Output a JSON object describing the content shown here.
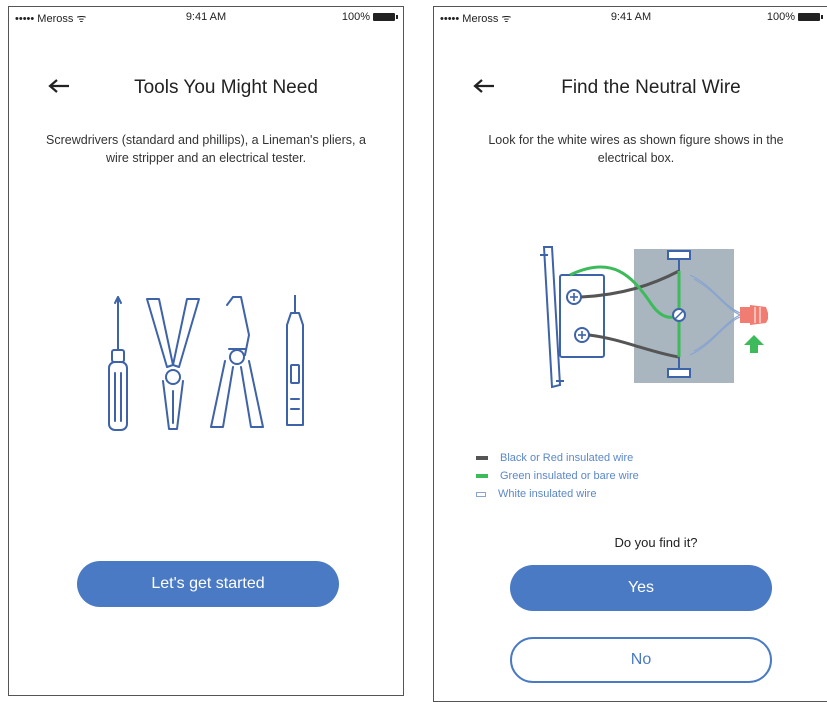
{
  "screens": [
    {
      "status": {
        "carrier": "••••• Meross ᯤ",
        "time": "9:41 AM",
        "battery": "100%"
      },
      "title": "Tools You Might Need",
      "description": "Screwdrivers (standard and phillips), a Lineman's pliers, a wire stripper and an electrical tester.",
      "button": "Let's get started",
      "icons": [
        "back-arrow-icon",
        "screwdriver-icon",
        "lineman-pliers-icon",
        "wire-stripper-icon",
        "electrical-tester-icon"
      ]
    },
    {
      "status": {
        "carrier": "••••• Meross ᯤ",
        "time": "9:41 AM",
        "battery": "100%"
      },
      "title": "Find the Neutral Wire",
      "description": "Look for the white wires as shown figure shows in the electrical box.",
      "legend": [
        {
          "label": "Black or Red insulated wire",
          "color": "#555555"
        },
        {
          "label": "Green insulated or bare wire",
          "color": "#3dbb5a"
        },
        {
          "label": "White insulated wire",
          "color": "#ffffff"
        }
      ],
      "question": "Do you find it?",
      "yes_button": "Yes",
      "no_button": "No",
      "icons": [
        "back-arrow-icon",
        "switch-wiring-diagram",
        "wire-connector-icon",
        "up-arrow-icon"
      ]
    }
  ],
  "colors": {
    "accent": "#4a7ac4",
    "illustration": "#3e63a8",
    "green": "#3dbb5a",
    "connector": "#f07c72"
  }
}
